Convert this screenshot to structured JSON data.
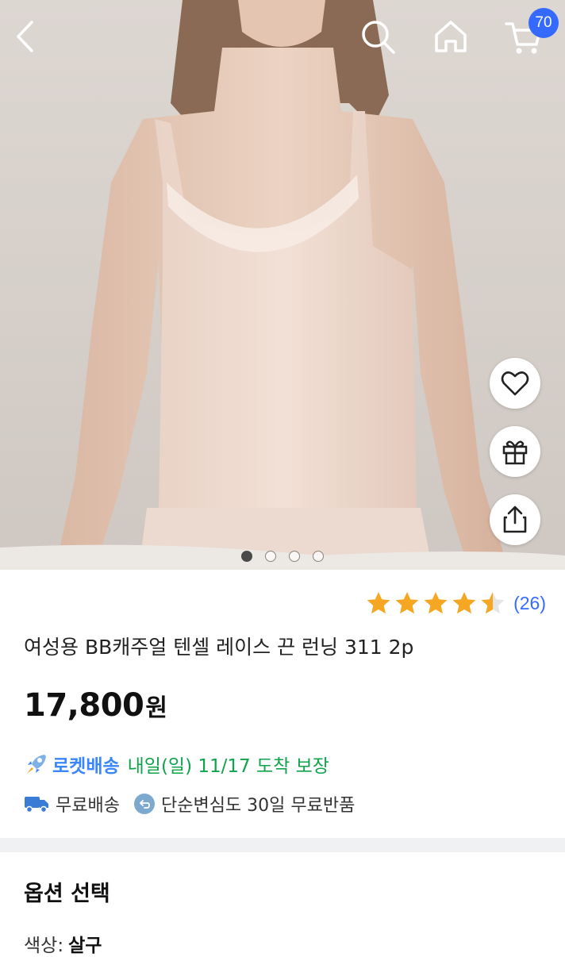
{
  "header": {
    "cart_count": "70",
    "icons": [
      "back-icon",
      "search-icon",
      "home-icon",
      "cart-icon"
    ]
  },
  "hero": {
    "image_count": 4,
    "active_index": 0,
    "side_actions": [
      "heart-icon",
      "gift-icon",
      "share-icon"
    ]
  },
  "product": {
    "rating": 4.5,
    "review_count": "(26)",
    "title": "여성용 BB캐주얼 텐셀 레이스 끈 런닝 311 2p",
    "price": "17,800",
    "price_unit": "원",
    "rocket_label": "로켓배송",
    "delivery_eta": "내일(일) 11/17 도착 보장",
    "free_shipping": "무료배송",
    "free_return": "단순변심도 30일 무료반품"
  },
  "options": {
    "heading": "옵션 선택",
    "color_label": "색상:",
    "color_value": "살구"
  },
  "colors": {
    "accent_blue": "#346aff",
    "star_orange": "#f5a623",
    "eta_green": "#11a34b"
  }
}
